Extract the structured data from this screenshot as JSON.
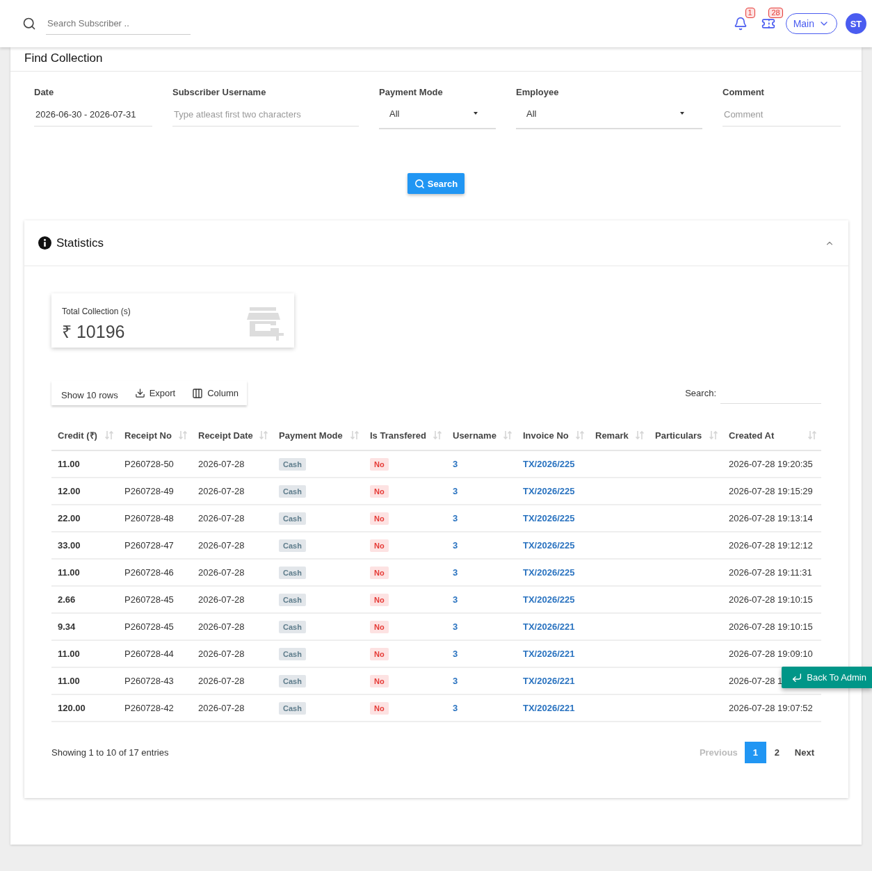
{
  "header": {
    "search": {
      "placeholder": "Search Subscriber .."
    },
    "notification_count": "1",
    "ticket_count": "28",
    "branch": "Main",
    "avatar": "ST"
  },
  "find_collection": {
    "title": "Find Collection",
    "filters": [
      {
        "kind": "text",
        "label": "Date",
        "value": "2026-06-30 - 2026-07-31"
      },
      {
        "kind": "text",
        "label": "Subscriber Username",
        "placeholder": "Type atleast first two characters"
      },
      {
        "kind": "select",
        "label": "Payment Mode",
        "value": "All"
      },
      {
        "kind": "select",
        "label": "Employee",
        "value": "All"
      },
      {
        "kind": "text",
        "label": "Comment",
        "placeholder": "Comment"
      }
    ],
    "search_button": "Search"
  },
  "statistics": {
    "title": "Statistics",
    "expanded": true,
    "total": {
      "label": "Total Collection (s)",
      "value": "₹ 10196"
    },
    "toolbar": {
      "show_rows": "Show 10 rows",
      "export": "Export",
      "column": "Column"
    },
    "search_label": "Search:",
    "columns": [
      "Credit (₹)",
      "Receipt No",
      "Receipt Date",
      "Payment Mode",
      "Is Transfered",
      "Username",
      "Invoice No",
      "Remark",
      "Particulars",
      "Created At"
    ],
    "rows": [
      {
        "credit": "11.00",
        "receipt_no": "P260728-50",
        "receipt_date": "2026-07-28",
        "payment_mode": "Cash",
        "is_transfered": "No",
        "username": "3",
        "invoice_no": "TX/2026/225",
        "created_at": "2026-07-28 19:20:35"
      },
      {
        "credit": "12.00",
        "receipt_no": "P260728-49",
        "receipt_date": "2026-07-28",
        "payment_mode": "Cash",
        "is_transfered": "No",
        "username": "3",
        "invoice_no": "TX/2026/225",
        "created_at": "2026-07-28 19:15:29"
      },
      {
        "credit": "22.00",
        "receipt_no": "P260728-48",
        "receipt_date": "2026-07-28",
        "payment_mode": "Cash",
        "is_transfered": "No",
        "username": "3",
        "invoice_no": "TX/2026/225",
        "created_at": "2026-07-28 19:13:14"
      },
      {
        "credit": "33.00",
        "receipt_no": "P260728-47",
        "receipt_date": "2026-07-28",
        "payment_mode": "Cash",
        "is_transfered": "No",
        "username": "3",
        "invoice_no": "TX/2026/225",
        "created_at": "2026-07-28 19:12:12"
      },
      {
        "credit": "11.00",
        "receipt_no": "P260728-46",
        "receipt_date": "2026-07-28",
        "payment_mode": "Cash",
        "is_transfered": "No",
        "username": "3",
        "invoice_no": "TX/2026/225",
        "created_at": "2026-07-28 19:11:31"
      },
      {
        "credit": "2.66",
        "receipt_no": "P260728-45",
        "receipt_date": "2026-07-28",
        "payment_mode": "Cash",
        "is_transfered": "No",
        "username": "3",
        "invoice_no": "TX/2026/225",
        "created_at": "2026-07-28 19:10:15"
      },
      {
        "credit": "9.34",
        "receipt_no": "P260728-45",
        "receipt_date": "2026-07-28",
        "payment_mode": "Cash",
        "is_transfered": "No",
        "username": "3",
        "invoice_no": "TX/2026/221",
        "created_at": "2026-07-28 19:10:15"
      },
      {
        "credit": "11.00",
        "receipt_no": "P260728-44",
        "receipt_date": "2026-07-28",
        "payment_mode": "Cash",
        "is_transfered": "No",
        "username": "3",
        "invoice_no": "TX/2026/221",
        "created_at": "2026-07-28 19:09:10"
      },
      {
        "credit": "11.00",
        "receipt_no": "P260728-43",
        "receipt_date": "2026-07-28",
        "payment_mode": "Cash",
        "is_transfered": "No",
        "username": "3",
        "invoice_no": "TX/2026/221",
        "created_at": "2026-07-28 1"
      },
      {
        "credit": "120.00",
        "receipt_no": "P260728-42",
        "receipt_date": "2026-07-28",
        "payment_mode": "Cash",
        "is_transfered": "No",
        "username": "3",
        "invoice_no": "TX/2026/221",
        "created_at": "2026-07-28 19:07:52"
      }
    ],
    "info": "Showing 1 to 10 of 17 entries",
    "pagination": {
      "previous": {
        "label": "Previous",
        "disabled": true
      },
      "pages": [
        {
          "label": "1",
          "selected": true
        },
        {
          "label": "2",
          "selected": false
        }
      ],
      "next": {
        "label": "Next",
        "disabled": false
      }
    }
  },
  "back_button": "Back To Admin"
}
